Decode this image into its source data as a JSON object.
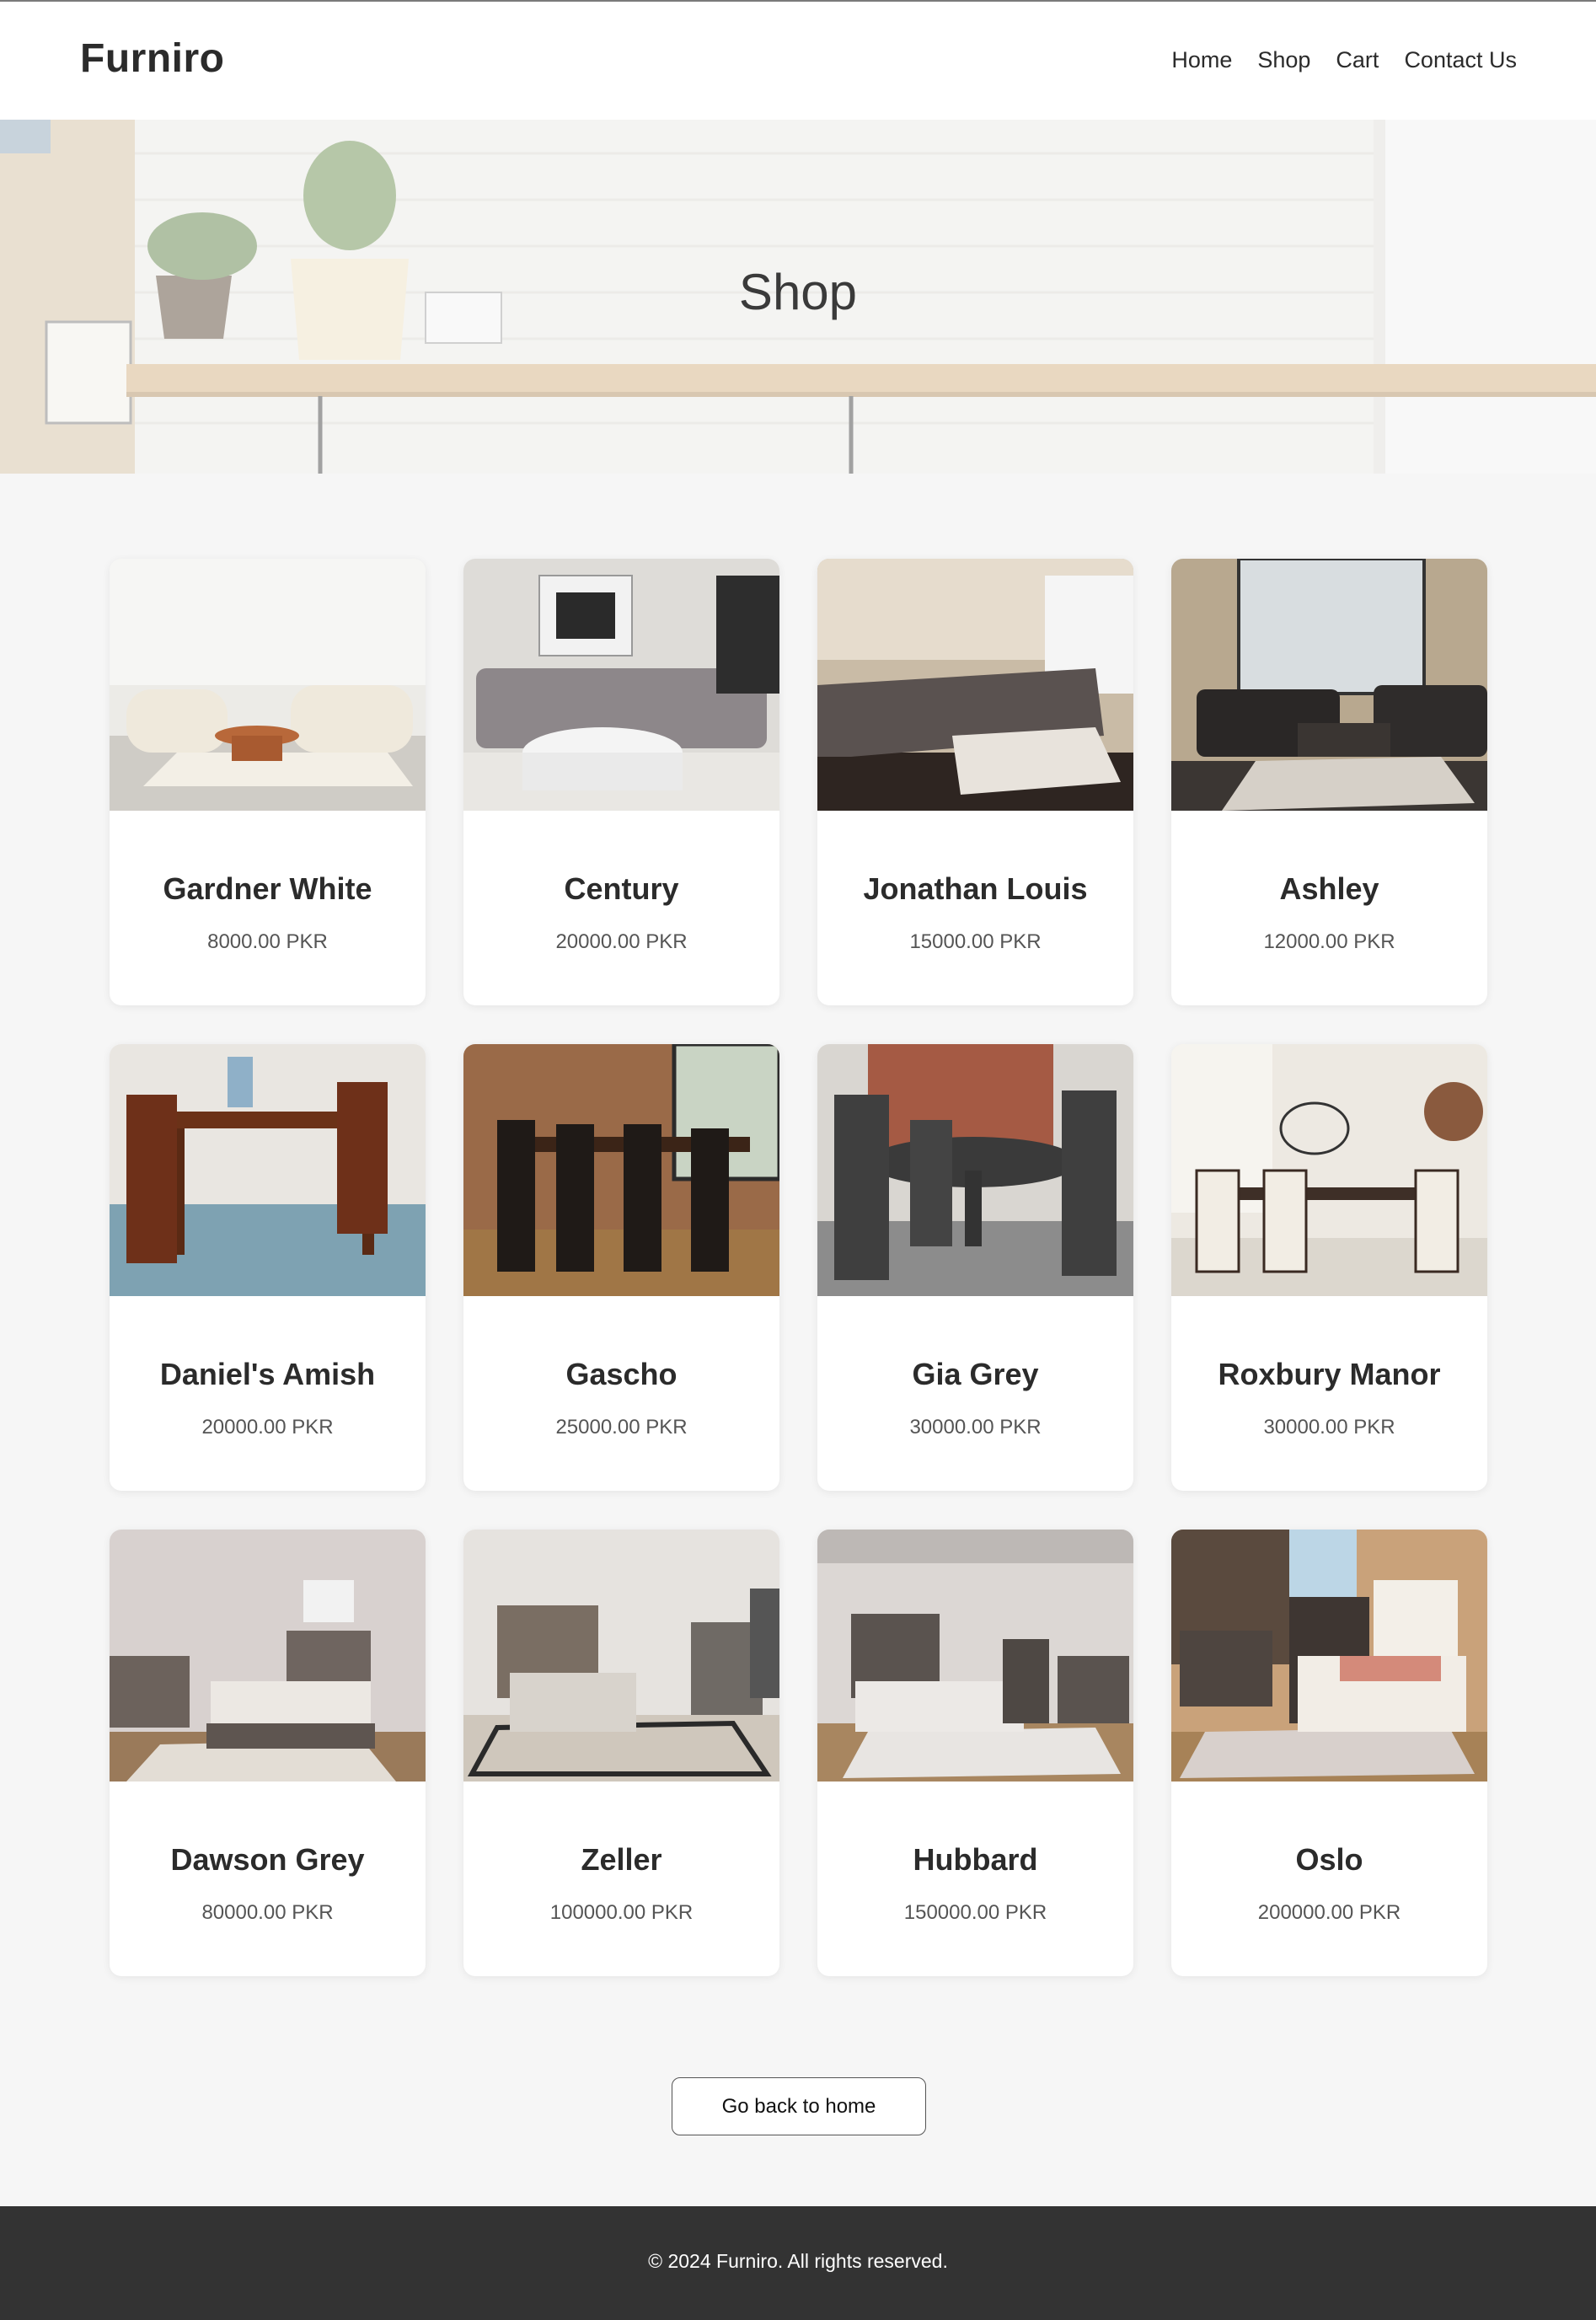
{
  "header": {
    "logo": "Furniro",
    "nav": [
      "Home",
      "Shop",
      "Cart",
      "Contact Us"
    ]
  },
  "hero": {
    "title": "Shop"
  },
  "products": [
    {
      "name": "Gardner White",
      "price": "8000.00 PKR"
    },
    {
      "name": "Century",
      "price": "20000.00 PKR"
    },
    {
      "name": "Jonathan Louis",
      "price": "15000.00 PKR"
    },
    {
      "name": "Ashley",
      "price": "12000.00 PKR"
    },
    {
      "name": "Daniel's Amish",
      "price": "20000.00 PKR"
    },
    {
      "name": "Gascho",
      "price": "25000.00 PKR"
    },
    {
      "name": "Gia Grey",
      "price": "30000.00 PKR"
    },
    {
      "name": "Roxbury Manor",
      "price": "30000.00 PKR"
    },
    {
      "name": "Dawson Grey",
      "price": "80000.00 PKR"
    },
    {
      "name": "Zeller",
      "price": "100000.00 PKR"
    },
    {
      "name": "Hubbard",
      "price": "150000.00 PKR"
    },
    {
      "name": "Oslo",
      "price": "200000.00 PKR"
    }
  ],
  "back_button": "Go back to home",
  "footer": {
    "copyright": "© 2024 Furniro. All rights reserved."
  },
  "colors": {
    "footer_bg": "#333333",
    "page_bg": "#f6f6f6",
    "text_dark": "#2b2b2b"
  }
}
